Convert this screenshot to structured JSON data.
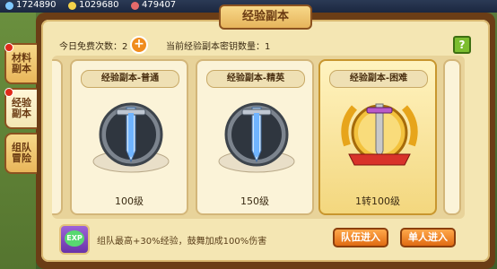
{
  "window": {
    "title": "经验副本"
  },
  "top_bar": {
    "res1": "1724890",
    "res2": "1029680",
    "res3": "479407"
  },
  "tabs": [
    {
      "label": "材料副本",
      "active": false,
      "badge": true
    },
    {
      "label": "经验副本",
      "active": true,
      "badge": true
    },
    {
      "label": "组队冒险",
      "active": false,
      "badge": false
    }
  ],
  "info": {
    "free_label": "今日免费次数：",
    "free_count": "2",
    "keys_label": "当前经验副本密钥数量：",
    "keys_count": "1",
    "help_icon": "?"
  },
  "cards": [
    {
      "title": "经验副本-普通",
      "level": "100级",
      "selected": false,
      "emblem": "sword-silver"
    },
    {
      "title": "经验副本-精英",
      "level": "150级",
      "selected": false,
      "emblem": "sword-silver"
    },
    {
      "title": "经验副本-困难",
      "level": "1转100级",
      "selected": true,
      "emblem": "sword-gold-laurel"
    }
  ],
  "bottom": {
    "exp_icon_text": "EXP",
    "description": "组队最高+30%经验，鼓舞加成100%伤害",
    "team_enter_label": "队伍进入",
    "solo_enter_label": "单人进入"
  }
}
